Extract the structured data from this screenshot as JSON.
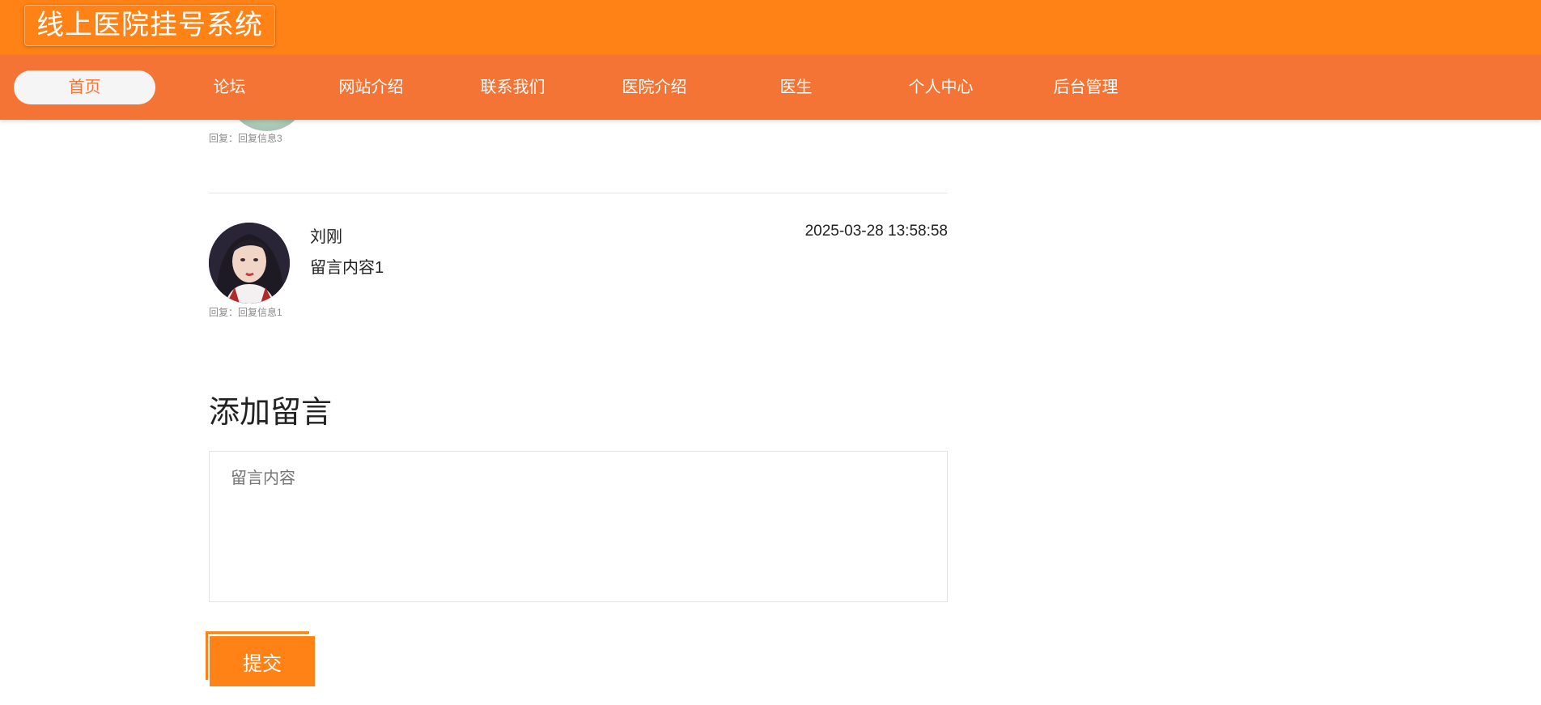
{
  "header": {
    "site_title": "线上医院挂号系统"
  },
  "nav": {
    "items": [
      {
        "label": "首页"
      },
      {
        "label": "论坛"
      },
      {
        "label": "网站介绍"
      },
      {
        "label": "联系我们"
      },
      {
        "label": "医院介绍"
      },
      {
        "label": "医生"
      },
      {
        "label": "个人中心"
      },
      {
        "label": "后台管理"
      }
    ],
    "active": "首页"
  },
  "messages": [
    {
      "reply": "回复：回复信息3"
    },
    {
      "author": "刘刚",
      "timestamp": "2025-03-28 13:58:58",
      "content": "留言内容1",
      "reply": "回复：回复信息1"
    }
  ],
  "form": {
    "title": "添加留言",
    "placeholder": "留言内容",
    "submit_label": "提交"
  },
  "colors": {
    "header_bg": "#ff8216",
    "nav_bg": "#f37435",
    "accent": "#ff8216"
  }
}
